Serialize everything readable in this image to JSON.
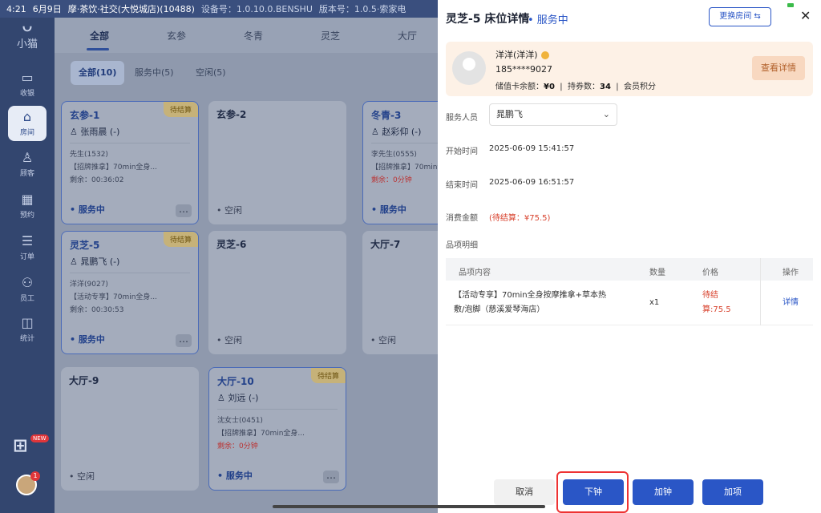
{
  "status_bar": {
    "time": "4:21",
    "date": "6月9日",
    "store": "摩·茶饮·社交(大悦城店)(10488)",
    "device_no": "设备号：1.0.10.0.BENSHU",
    "version": "版本号：1.0.5·索家电"
  },
  "sidebar": {
    "logo_text": "小猫",
    "items": [
      {
        "label": "收银",
        "icon": "monitor-icon"
      },
      {
        "label": "房间",
        "icon": "home-icon",
        "active": true
      },
      {
        "label": "顾客",
        "icon": "user-icon"
      },
      {
        "label": "预约",
        "icon": "calendar-icon"
      },
      {
        "label": "订单",
        "icon": "list-icon"
      },
      {
        "label": "员工",
        "icon": "staff-icon"
      },
      {
        "label": "统计",
        "icon": "chart-icon"
      }
    ],
    "new_badge": "NEW",
    "avatar_badge": "1"
  },
  "main": {
    "tabs": [
      "全部",
      "玄参",
      "冬青",
      "灵芝",
      "大厅"
    ],
    "filters": [
      "全部(10)",
      "服务中(5)",
      "空闲(5)"
    ],
    "cards": [
      {
        "name": "玄参-1",
        "tag": "待结算",
        "staff": "张雨晨 (-)",
        "line1": "先生(1532)",
        "line2": "【招牌推拿】70min全身...",
        "remain": "剩余：00:36:02",
        "status": "服务中",
        "busy": true
      },
      {
        "name": "玄参-2",
        "status": "空闲",
        "busy": false
      },
      {
        "name": "冬青-3",
        "staff": "赵彩仰 (-)",
        "line1": "李先生(0555)",
        "line2": "【招牌推拿】70min全...",
        "remain": "剩余：0分钟",
        "status": "服务中",
        "busy": true
      },
      {
        "name": "灵芝-5",
        "tag": "待结算",
        "staff": "晁鹏飞 (-)",
        "line1": "洋洋(9027)",
        "line2": "【活动专享】70min全身...",
        "remain": "剩余：00:30:53",
        "status": "服务中",
        "busy": true
      },
      {
        "name": "灵芝-6",
        "status": "空闲",
        "busy": false
      },
      {
        "name": "大厅-7",
        "status": "空闲",
        "busy": false
      },
      {
        "name": "大厅-9",
        "status": "空闲",
        "busy": false
      },
      {
        "name": "大厅-10",
        "tag": "待结算",
        "staff": "刘远 (-)",
        "line1": "沈女士(0451)",
        "line2": "【招牌推拿】70min全身...",
        "remain": "剩余：0分钟",
        "status": "服务中",
        "busy": true
      }
    ]
  },
  "panel": {
    "title": "灵芝-5 床位详情",
    "status": "• 服务中",
    "change_room": "更换房间 ⇆",
    "member": {
      "name": "洋洋(洋洋)",
      "phone": "185****9027",
      "balance_label": "储值卡余额：",
      "balance": "¥0",
      "coupons_label": "持券数：",
      "coupons": "34",
      "points_label": "会员积分",
      "detail_button": "查看详情"
    },
    "staff_label": "服务人员",
    "staff_value": "晁鹏飞",
    "start_label": "开始时间",
    "start_value": "2025-06-09 15:41:57",
    "end_label": "结束时间",
    "end_value": "2025-06-09 16:51:57",
    "amount_label": "消费金额",
    "amount_value": "(待结算：¥75.5)",
    "items_label": "品项明细",
    "table": {
      "headers": [
        "品项内容",
        "数量",
        "价格",
        "操作"
      ],
      "rows": [
        {
          "content_1": "【活动专享】70min全身按摩推拿+草本热",
          "content_2": "敷/泡脚（慈溪爱琴海店）",
          "qty": "x1",
          "price_1": "待结",
          "price_2": "算:75.5",
          "op": "详情"
        }
      ]
    },
    "buttons": {
      "cancel": "取消",
      "end_clock": "下钟",
      "add_clock": "加钟",
      "add_item": "加项"
    }
  }
}
